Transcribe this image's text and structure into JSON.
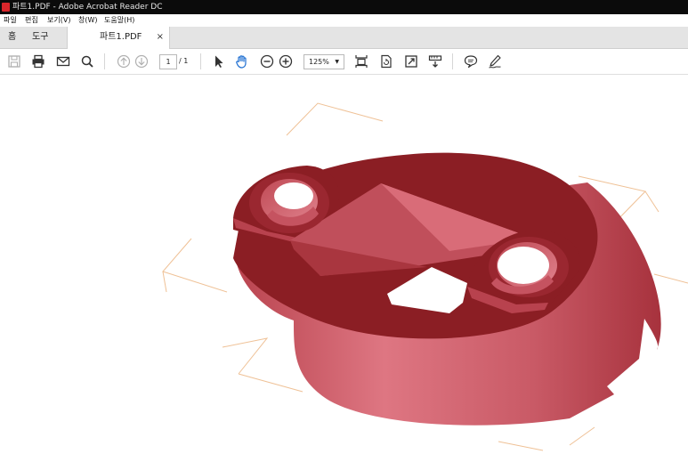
{
  "window": {
    "title": "파트1.PDF - Adobe Acrobat Reader DC"
  },
  "menu": {
    "items": [
      "파일",
      "편집",
      "보기(V)",
      "창(W)",
      "도움말(H)"
    ]
  },
  "tabs": {
    "home": "홈",
    "tools": "도구",
    "document": "파트1.PDF",
    "close": "×"
  },
  "toolbar": {
    "page_current": "1",
    "page_total": "/ 1",
    "zoom": "125%",
    "icons": [
      "save-icon",
      "print-icon",
      "email-icon",
      "search-icon",
      "page-up-icon",
      "page-down-icon",
      "select-cursor-icon",
      "hand-icon",
      "zoom-out-icon",
      "zoom-in-icon",
      "fit-page-icon",
      "rotate-icon",
      "fullscreen-icon",
      "scroll-mode-icon",
      "comment-icon",
      "sign-icon"
    ]
  },
  "colors": {
    "model_dark": "#8b1e24",
    "model_light": "#dd7480",
    "axes": "#e7b07f",
    "titlebar": "#0b0b0b"
  }
}
